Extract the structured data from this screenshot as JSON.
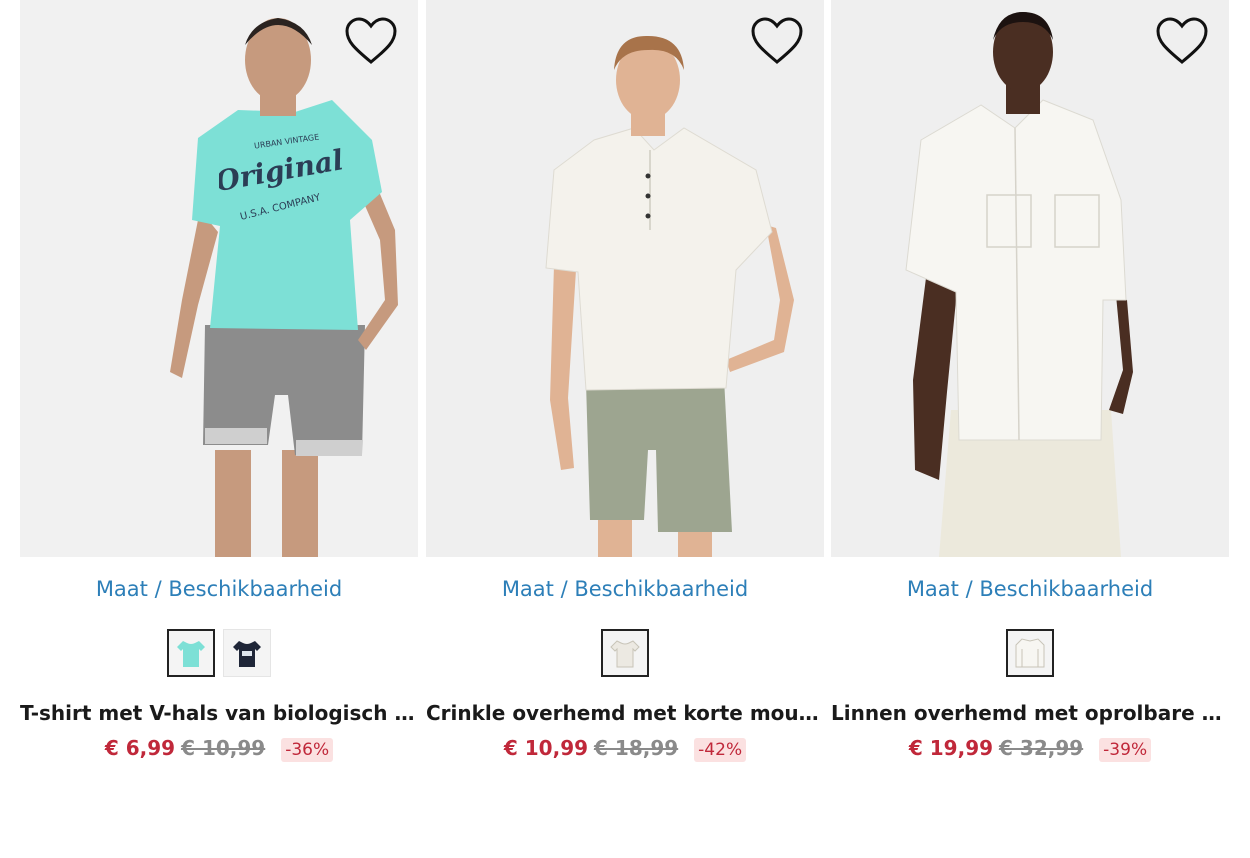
{
  "products": [
    {
      "size_link": "Maat / Beschikbaarheid",
      "title": "T-shirt met V-hals van biologisch katoen",
      "price_now": "€ 6,99",
      "price_old": "€ 10,99",
      "discount": "-36%",
      "colors": {
        "shirt": "#7de0d6",
        "shorts": "#8c8c8c",
        "skin": "#c69a7e",
        "bg": "#f1f1f1"
      },
      "swatches": [
        {
          "color": "#7de0d6",
          "selected": true
        },
        {
          "color": "#1f2638",
          "selected": false
        }
      ]
    },
    {
      "size_link": "Maat / Beschikbaarheid",
      "title": "Crinkle overhemd met korte mouwen",
      "price_now": "€ 10,99",
      "price_old": "€ 18,99",
      "discount": "-42%",
      "colors": {
        "shirt": "#f4f2ec",
        "shorts": "#9da590",
        "skin": "#e0b394",
        "bg": "#efefef"
      },
      "swatches": [
        {
          "color": "#ece9e2",
          "selected": true
        }
      ]
    },
    {
      "size_link": "Maat / Beschikbaarheid",
      "title": "Linnen overhemd met oprolbare mouwen",
      "price_now": "€ 19,99",
      "price_old": "€ 32,99",
      "discount": "-39%",
      "colors": {
        "shirt": "#f7f6f2",
        "shorts": "#ece9dc",
        "skin": "#4a2e22",
        "bg": "#efefef"
      },
      "swatches": [
        {
          "color": "#f7f6f2",
          "selected": true
        }
      ]
    }
  ],
  "tshirt_print": {
    "main": "Original",
    "top": "URBAN VINTAGE",
    "bottom": "U.S.A. COMPANY"
  },
  "icons": {
    "wishlist": "heart-outline-icon"
  }
}
